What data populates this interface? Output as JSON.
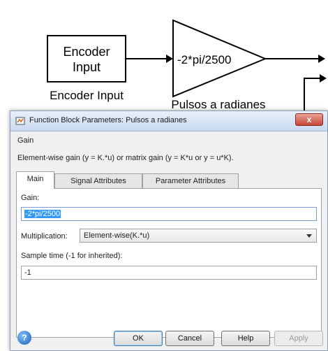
{
  "diagram": {
    "encoder_block_text_line1": "Encoder",
    "encoder_block_text_line2": "Input",
    "encoder_block_name": "Encoder Input",
    "gain_block_text": "-2*pi/2500",
    "gain_block_name": "Pulsos a radianes"
  },
  "dialog": {
    "title": "Function Block Parameters: Pulsos a radianes",
    "close_symbol": "x",
    "section_label": "Gain",
    "description": "Element-wise gain (y = K.*u) or matrix gain (y = K*u or y = u*K).",
    "tabs": [
      {
        "label": "Main"
      },
      {
        "label": "Signal Attributes"
      },
      {
        "label": "Parameter Attributes"
      }
    ],
    "gain_label": "Gain:",
    "gain_value": "-2*pi/2500",
    "multiplication_label": "Multiplication:",
    "multiplication_value": "Element-wise(K.*u)",
    "sample_time_label": "Sample time (-1 for inherited):",
    "sample_time_value": "-1",
    "buttons": {
      "ok": "OK",
      "cancel": "Cancel",
      "help": "Help",
      "apply": "Apply"
    },
    "help_icon_symbol": "?"
  },
  "icons": [
    "simulink-block-icon",
    "help-icon",
    "dropdown-arrow-icon",
    "close-icon"
  ],
  "colors": {
    "selection": "#3399ff",
    "close_button": "#c9473a",
    "titlebar": "#c9d9ee"
  }
}
